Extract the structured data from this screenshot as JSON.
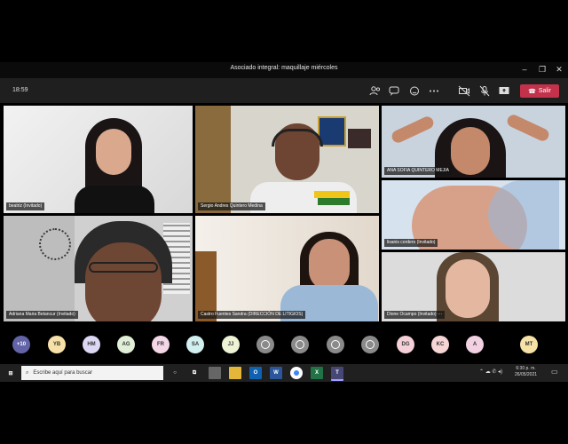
{
  "window": {
    "title": "Asociado integral: maquillaje miércoles"
  },
  "toolbar": {
    "time": "18:59",
    "leave_label": "Salir"
  },
  "participants_video": [
    {
      "name": "beatriz (Invitado)"
    },
    {
      "name": "Sergio Andres Quintero Medina"
    },
    {
      "name": "ANA SOFIA QUINTERO MEJIA"
    },
    {
      "name": "lisanis cordero (Invitado)"
    },
    {
      "name": "Adriana Maria Betancur (Invitado)"
    },
    {
      "name": "Castro Fuentes Sandra (DIRECCIÓN DE LITIGIOS)"
    },
    {
      "name": "Dione Ocampo (Invitado)"
    }
  ],
  "avatars": [
    {
      "initials": "+10",
      "color": "#6264a7"
    },
    {
      "initials": "YB",
      "color": "#f7e1a8"
    },
    {
      "initials": "HM",
      "color": "#dcd8f4"
    },
    {
      "initials": "AG",
      "color": "#e1efd8"
    },
    {
      "initials": "FR",
      "color": "#f4d8e8"
    },
    {
      "initials": "SA",
      "color": "#d3f0f0"
    },
    {
      "initials": "JJ",
      "color": "#eef3d6"
    },
    {
      "initials": "",
      "color": "#8a8a8a"
    },
    {
      "initials": "",
      "color": "#8a8a8a"
    },
    {
      "initials": "",
      "color": "#8a8a8a"
    },
    {
      "initials": "",
      "color": "#8a8a8a"
    },
    {
      "initials": "DG",
      "color": "#f5d0d8"
    },
    {
      "initials": "KC",
      "color": "#f6d5d5"
    },
    {
      "initials": "A",
      "color": "#f2d2e2"
    },
    {
      "initials": "MT",
      "color": "#f6e2a6"
    }
  ],
  "taskbar": {
    "search_placeholder": "Escribe aquí para buscar",
    "clock_time": "6:30 p. m.",
    "clock_date": "26/05/2021"
  },
  "colors": {
    "leave": "#c4314b",
    "toolbar": "#1f1f1f",
    "accent": "#6264a7"
  }
}
